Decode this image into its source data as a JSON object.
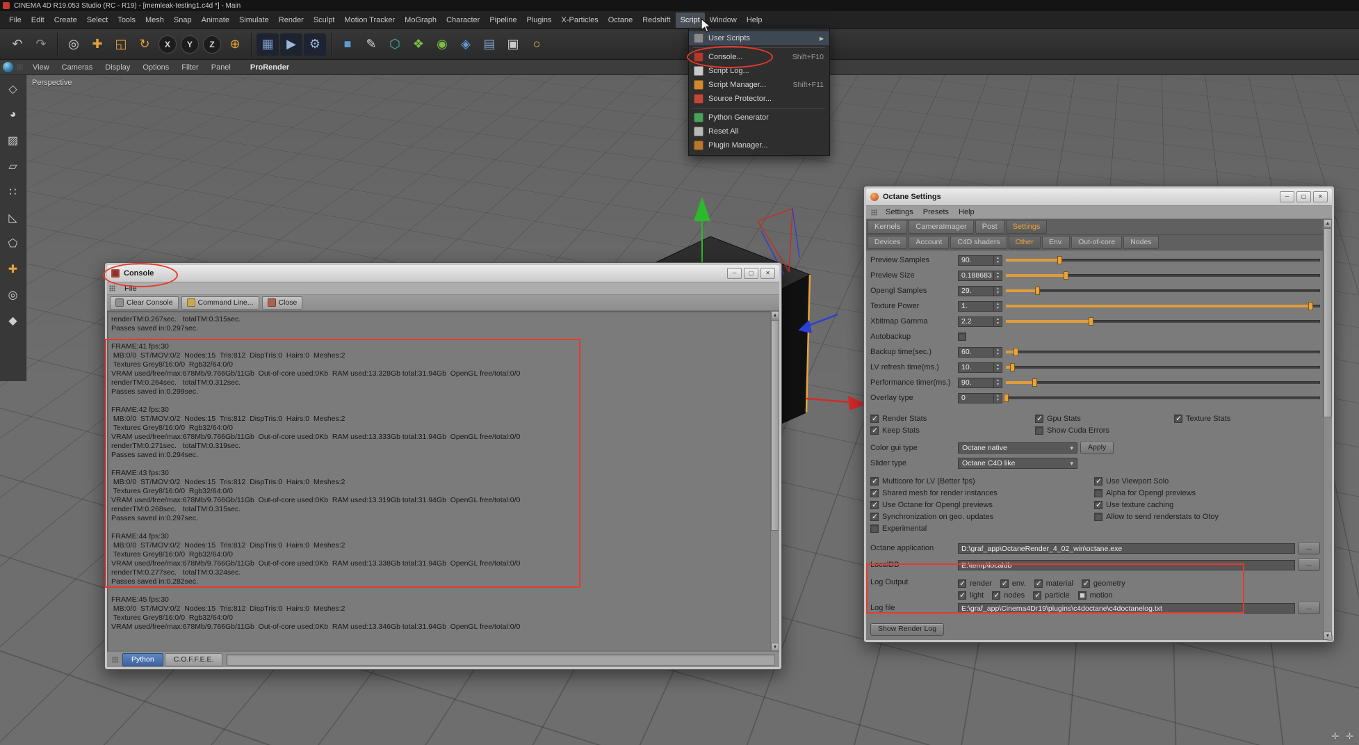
{
  "annotations": {
    "color": "#e8392b"
  },
  "titlebar": {
    "title": "CINEMA 4D R19.053 Studio (RC - R19) - [memleak-testing1.c4d *] - Main"
  },
  "menubar": {
    "items": [
      "File",
      "Edit",
      "Create",
      "Select",
      "Tools",
      "Mesh",
      "Snap",
      "Animate",
      "Simulate",
      "Render",
      "Sculpt",
      "Motion Tracker",
      "MoGraph",
      "Character",
      "Pipeline",
      "Plugins",
      "X-Particles",
      "Octane",
      "Redshift",
      "Script",
      "Window",
      "Help"
    ],
    "active": "Script"
  },
  "toolbar": {
    "icons": [
      {
        "name": "undo-icon",
        "glyph": "↶",
        "fg": "#c2c2c2"
      },
      {
        "name": "redo-icon",
        "glyph": "↷",
        "fg": "#8e8e8e"
      },
      {
        "separator": true
      },
      {
        "name": "live-selection-icon",
        "glyph": "◎",
        "fg": "#d8d8d8"
      },
      {
        "name": "move-tool-icon",
        "glyph": "✚",
        "fg": "#e2a23c"
      },
      {
        "name": "scale-tool-icon",
        "glyph": "◱",
        "fg": "#e2a23c"
      },
      {
        "name": "rotate-tool-icon",
        "glyph": "↻",
        "fg": "#e2a23c"
      },
      {
        "name": "x-axis-lock-icon",
        "glyph": "X",
        "fg": "#d8d8d8",
        "circle": true
      },
      {
        "name": "y-axis-lock-icon",
        "glyph": "Y",
        "fg": "#d8d8d8",
        "circle": true
      },
      {
        "name": "z-axis-lock-icon",
        "glyph": "Z",
        "fg": "#d8d8d8",
        "circle": true
      },
      {
        "name": "coordinate-system-icon",
        "glyph": "⊕",
        "fg": "#e2a23c"
      },
      {
        "separator": true
      },
      {
        "name": "render-view-icon",
        "glyph": "▦",
        "fg": "#7e9cc4",
        "bg": "#1d2330"
      },
      {
        "name": "render-picture-viewer-icon",
        "glyph": "▶",
        "fg": "#9db6d6",
        "bg": "#1d2330"
      },
      {
        "name": "render-settings-icon",
        "glyph": "⚙",
        "fg": "#9db6d6",
        "bg": "#1d2330"
      },
      {
        "separator": true
      },
      {
        "name": "add-cube-icon",
        "glyph": "■",
        "fg": "#5e9bd6"
      },
      {
        "name": "pen-tool-icon",
        "glyph": "✎",
        "fg": "#d8d8d8"
      },
      {
        "name": "subdivision-surface-icon",
        "glyph": "⬡",
        "fg": "#44b29e"
      },
      {
        "name": "mograph-cloner-icon",
        "glyph": "❖",
        "fg": "#7cc043"
      },
      {
        "name": "dynamics-icon",
        "glyph": "◉",
        "fg": "#7cc043"
      },
      {
        "name": "deformer-icon",
        "glyph": "◈",
        "fg": "#5e9bd6"
      },
      {
        "name": "environment-icon",
        "glyph": "▤",
        "fg": "#7fa6cc"
      },
      {
        "name": "camera-icon",
        "glyph": "▣",
        "fg": "#cccccc"
      },
      {
        "name": "light-icon",
        "glyph": "○",
        "fg": "#e6d24a"
      }
    ]
  },
  "viewbar": {
    "items": [
      "View",
      "Cameras",
      "Display",
      "Options",
      "Filter",
      "Panel",
      "ProRender"
    ]
  },
  "palette": {
    "icons": [
      {
        "name": "make-editable-icon",
        "glyph": "◇",
        "fg": "#cfcfcf"
      },
      {
        "name": "model-mode-icon",
        "glyph": "◕",
        "fg": "#cfcfcf"
      },
      {
        "name": "texture-mode-icon",
        "glyph": "▨",
        "fg": "#cfcfcf"
      },
      {
        "name": "workplane-mode-icon",
        "glyph": "▱",
        "fg": "#cfcfcf"
      },
      {
        "name": "points-mode-icon",
        "glyph": "∷",
        "fg": "#cfcfcf"
      },
      {
        "name": "edges-mode-icon",
        "glyph": "◺",
        "fg": "#cfcfcf"
      },
      {
        "name": "polygons-mode-icon",
        "glyph": "⬠",
        "fg": "#cfcfcf"
      },
      {
        "name": "enable-axis-icon",
        "glyph": "✚",
        "fg": "#e2a23c"
      },
      {
        "name": "viewport-solo-icon",
        "glyph": "◎",
        "fg": "#cfcfcf"
      },
      {
        "name": "snap-settings-icon",
        "glyph": "◆",
        "fg": "#cfcfcf"
      }
    ]
  },
  "viewport": {
    "label": "Perspective"
  },
  "script_menu": {
    "header": "Script",
    "items": [
      {
        "label": "User Scripts",
        "submenu": true,
        "highlight": true,
        "icon": "user-scripts-icon",
        "icon_color": "#8a8a8a"
      },
      {
        "separator": true
      },
      {
        "label": "Console...",
        "shortcut": "Shift+F10",
        "icon": "console-icon",
        "icon_color": "#b03a2e"
      },
      {
        "label": "Script Log...",
        "icon": "script-log-icon",
        "icon_color": "#c9c9c9"
      },
      {
        "label": "Script Manager...",
        "shortcut": "Shift+F11",
        "icon": "script-manager-icon",
        "icon_color": "#d08a2e"
      },
      {
        "label": "Source Protector...",
        "icon": "source-protector-icon",
        "icon_color": "#c2483a"
      },
      {
        "separator": true
      },
      {
        "label": "Python Generator",
        "icon": "python-generator-icon",
        "icon_color": "#4aa05c"
      },
      {
        "label": "Reset All",
        "icon": "reset-all-icon",
        "icon_color": "#b8b8b8"
      },
      {
        "label": "Plugin Manager...",
        "icon": "plugin-manager-icon",
        "icon_color": "#b8762e"
      }
    ]
  },
  "console_window": {
    "title": "Console",
    "menu": [
      "File"
    ],
    "toolbar": [
      {
        "label": "Clear Console",
        "icon": "clear-console-icon",
        "icon_color": "#8f8f8f"
      },
      {
        "label": "Command Line...",
        "icon": "command-line-icon",
        "icon_color": "#caa84e"
      },
      {
        "label": "Close",
        "icon": "close-console-icon",
        "icon_color": "#b0614e"
      }
    ],
    "tabs": [
      "Python",
      "C.O.F.F.E.E."
    ],
    "active_tab": "Python",
    "lines": [
      "renderTM:0.267sec.   totalTM:0.315sec.",
      "Passes saved in:0.297sec.",
      "",
      "FRAME:41 fps:30",
      " MB:0/0  ST/MOV:0/2  Nodes:15  Tris:812  DispTris:0  Hairs:0  Meshes:2",
      " Textures Grey8/16:0/0  Rgb32/64:0/0",
      "VRAM used/free/max:678Mb/9.766Gb/11Gb  Out-of-core used:0Kb  RAM used:13.328Gb total:31.94Gb  OpenGL free/total:0/0",
      "renderTM:0.264sec.   totalTM:0.312sec.",
      "Passes saved in:0.299sec.",
      "",
      "FRAME:42 fps:30",
      " MB:0/0  ST/MOV:0/2  Nodes:15  Tris:812  DispTris:0  Hairs:0  Meshes:2",
      " Textures Grey8/16:0/0  Rgb32/64:0/0",
      "VRAM used/free/max:678Mb/9.766Gb/11Gb  Out-of-core used:0Kb  RAM used:13.333Gb total:31.94Gb  OpenGL free/total:0/0",
      "renderTM:0.271sec.   totalTM:0.319sec.",
      "Passes saved in:0.294sec.",
      "",
      "FRAME:43 fps:30",
      " MB:0/0  ST/MOV:0/2  Nodes:15  Tris:812  DispTris:0  Hairs:0  Meshes:2",
      " Textures Grey8/16:0/0  Rgb32/64:0/0",
      "VRAM used/free/max:678Mb/9.766Gb/11Gb  Out-of-core used:0Kb  RAM used:13.319Gb total:31.94Gb  OpenGL free/total:0/0",
      "renderTM:0.268sec.   totalTM:0.315sec.",
      "Passes saved in:0.297sec.",
      "",
      "FRAME:44 fps:30",
      " MB:0/0  ST/MOV:0/2  Nodes:15  Tris:812  DispTris:0  Hairs:0  Meshes:2",
      " Textures Grey8/16:0/0  Rgb32/64:0/0",
      "VRAM used/free/max:678Mb/9.766Gb/11Gb  Out-of-core used:0Kb  RAM used:13.338Gb total:31.94Gb  OpenGL free/total:0/0",
      "renderTM:0.277sec.   totalTM:0.324sec.",
      "Passes saved in:0.282sec.",
      "",
      "FRAME:45 fps:30",
      " MB:0/0  ST/MOV:0/2  Nodes:15  Tris:812  DispTris:0  Hairs:0  Meshes:2",
      " Textures Grey8/16:0/0  Rgb32/64:0/0",
      "VRAM used/free/max:678Mb/9.766Gb/11Gb  Out-of-core used:0Kb  RAM used:13.346Gb total:31.94Gb  OpenGL free/total:0/0"
    ]
  },
  "octane_window": {
    "title": "Octane Settings",
    "menu": [
      "Settings",
      "Presets",
      "Help"
    ],
    "tabs": [
      "Kernels",
      "CameraImager",
      "Post",
      "Settings"
    ],
    "active_tab": "Settings",
    "subtabs": [
      "Devices",
      "Account",
      "C4D shaders",
      "Other",
      "Env.",
      "Out-of-core",
      "Nodes"
    ],
    "active_subtab": "Other",
    "params": [
      {
        "label": "Preview Samples",
        "value": "90.",
        "fill": 17
      },
      {
        "label": "Preview Size",
        "value": "0.188683",
        "fill": 19
      },
      {
        "label": "Opengl Samples",
        "value": "29.",
        "fill": 10
      },
      {
        "label": "Texture Power",
        "value": "1.",
        "fill": 97
      },
      {
        "label": "Xbitmap Gamma",
        "value": "2.2",
        "fill": 27
      },
      {
        "label": "Autobackup",
        "checkbox": true,
        "checked": false
      },
      {
        "label": "Backup time(sec.)",
        "value": "60.",
        "fill": 3
      },
      {
        "label": "LV refresh time(ms.)",
        "value": "10.",
        "fill": 2
      },
      {
        "label": "Performance timer(ms.)",
        "value": "90.",
        "fill": 9
      },
      {
        "label": "Overlay type",
        "value": "0",
        "fill": 0
      }
    ],
    "stats_rows": [
      [
        {
          "label": "Render Stats",
          "checked": true
        },
        {
          "label": "Gpu Stats",
          "checked": true
        },
        {
          "label": "Texture Stats",
          "checked": true
        }
      ],
      [
        {
          "label": "Keep Stats",
          "checked": true
        },
        {
          "label": "Show Cuda Errors",
          "checked": false
        }
      ]
    ],
    "color_gui": {
      "label": "Color gui type",
      "value": "Octane native",
      "apply_label": "Apply"
    },
    "slider_type": {
      "label": "Slider type",
      "value": "Octane C4D like"
    },
    "options": [
      [
        {
          "label": "Multicore for LV (Better fps)",
          "checked": true
        },
        {
          "label": "Use Viewport Solo",
          "checked": true
        }
      ],
      [
        {
          "label": "Shared mesh for render instances",
          "checked": true
        },
        {
          "label": "Alpha for Opengl previews",
          "checked": false
        }
      ],
      [
        {
          "label": "Use Octane for Opengl previews",
          "checked": true
        },
        {
          "label": "Use texture caching",
          "checked": true
        }
      ],
      [
        {
          "label": "Synchronization on geo. updates",
          "checked": true
        },
        {
          "label": "Allow to send renderstats to Otoy",
          "checked": false
        }
      ],
      [
        {
          "label": "Experimental",
          "checked": false
        }
      ]
    ],
    "paths": [
      {
        "label": "Octane application",
        "value": "D:\\graf_app\\OctaneRender_4_02_win\\octane.exe",
        "browse": "..."
      },
      {
        "label": "LocalDB",
        "value": "E:\\temp\\localdb",
        "browse": "..."
      }
    ],
    "log_output": {
      "label": "Log Output",
      "rows": [
        [
          {
            "label": "render",
            "checked": true
          },
          {
            "label": "env.",
            "checked": true
          },
          {
            "label": "material",
            "checked": true
          },
          {
            "label": "geometry",
            "checked": true
          }
        ],
        [
          {
            "label": "light",
            "checked": true
          },
          {
            "label": "nodes",
            "checked": true
          },
          {
            "label": "particle",
            "checked": true
          },
          {
            "label": "motion",
            "checked": true,
            "partial": true
          }
        ]
      ]
    },
    "log_file": {
      "label": "Log file",
      "value": "E:\\graf_app\\Cinema4Dr19\\plugins\\c4doctane\\c4doctanelog.txt",
      "browse": "..."
    },
    "show_render_log_label": "Show Render Log"
  }
}
